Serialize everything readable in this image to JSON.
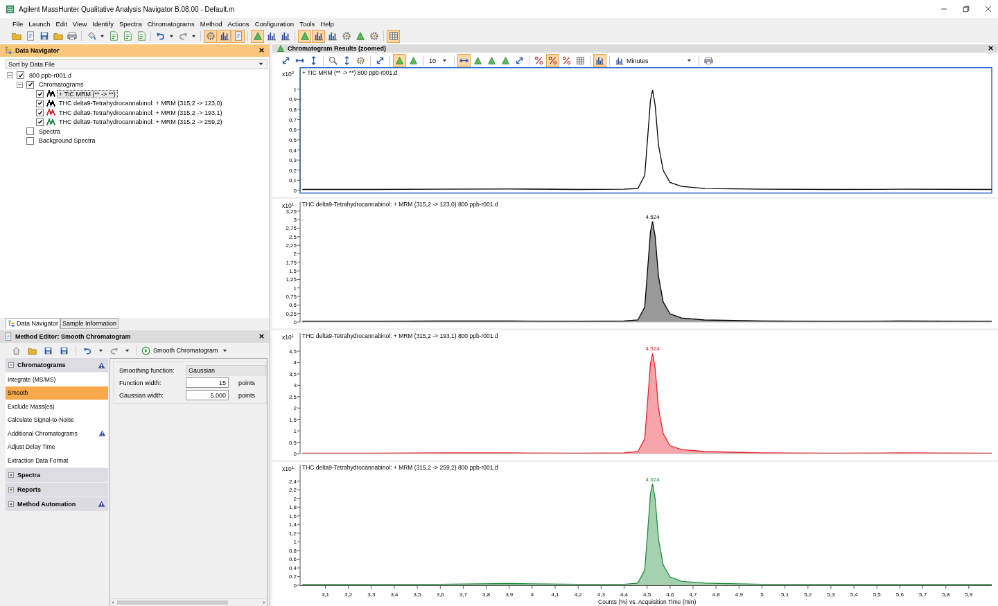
{
  "window": {
    "title": "Agilent MassHunter Qualitative Analysis Navigator B.08.00 - Default.m"
  },
  "menu": [
    "File",
    "Launch",
    "Edit",
    "View",
    "Identify",
    "Spectra",
    "Chromatograms",
    "Method",
    "Actions",
    "Configuration",
    "Tools",
    "Help"
  ],
  "main_toolbar": [
    {
      "pressed": false
    },
    {
      "pressed": false
    },
    {
      "pressed": false
    },
    {
      "pressed": false
    },
    {
      "pressed": false
    },
    {
      "pressed": false
    },
    {
      "pressed": false
    },
    {
      "pressed": false
    },
    {
      "pressed": false
    },
    {
      "pressed": false
    },
    {
      "pressed": false
    },
    {
      "pressed": true
    },
    {
      "pressed": true
    },
    {
      "pressed": true
    },
    {
      "pressed": true
    },
    {
      "pressed": false
    },
    {
      "pressed": false
    },
    {
      "pressed": true
    },
    {
      "pressed": true
    },
    {
      "pressed": false
    },
    {
      "pressed": false
    },
    {
      "pressed": false
    },
    {
      "pressed": false
    },
    {
      "pressed": true
    }
  ],
  "data_navigator": {
    "title": "Data Navigator",
    "sort": "Sort by Data File",
    "tree": [
      {
        "label": "800 ppb-r001.d",
        "checked": true,
        "expanded": true,
        "children": [
          {
            "label": "Chromatograms",
            "checked": true,
            "expanded": true,
            "children": [
              {
                "label": "+ TIC MRM (** -> **)",
                "checked": true,
                "color": "#000000",
                "selected": true
              },
              {
                "label": "THC  delta9-Tetrahydrocannabinol: + MRM (315,2 -> 123,0)",
                "checked": true,
                "color": "#000000",
                "selected": false
              },
              {
                "label": "THC  delta9-Tetrahydrocannabinol: + MRM (315,2 -> 193,1)",
                "checked": true,
                "color": "#e8202a",
                "selected": false
              },
              {
                "label": "THC  delta9-Tetrahydrocannabinol: + MRM (315,2 -> 259,2)",
                "checked": true,
                "color": "#1e8c3c",
                "selected": false
              }
            ]
          },
          {
            "label": "Spectra",
            "checked": false
          },
          {
            "label": "Background Spectra",
            "checked": false
          }
        ]
      }
    ]
  },
  "left_tabs": [
    {
      "label": "Data Navigator",
      "selected": true
    },
    {
      "label": "Sample Information",
      "selected": false
    }
  ],
  "method_editor": {
    "title": "Method Editor: Smooth Chromatogram",
    "action": "Smooth Chromatogram",
    "groups": [
      {
        "label": "Chromatograms",
        "expanded": true,
        "alert": true,
        "items": [
          {
            "label": "Integrate (MS/MS)",
            "selected": false,
            "alert": false
          },
          {
            "label": "Smooth",
            "selected": true,
            "alert": false
          },
          {
            "label": "Exclude Mass(es)",
            "selected": false,
            "alert": false
          },
          {
            "label": "Calculate Signal-to-Noise",
            "selected": false,
            "alert": false
          },
          {
            "label": "Additional Chromatograms",
            "selected": false,
            "alert": true
          },
          {
            "label": "Adjust Delay Time",
            "selected": false,
            "alert": false
          },
          {
            "label": "Extraction Data Format",
            "selected": false,
            "alert": false
          }
        ]
      },
      {
        "label": "Spectra",
        "expanded": false,
        "alert": false
      },
      {
        "label": "Reports",
        "expanded": false,
        "alert": false
      },
      {
        "label": "Method Automation",
        "expanded": false,
        "alert": true
      }
    ],
    "fields": [
      {
        "label": "Smoothing function:",
        "value": "Gaussian",
        "kind": "readonly"
      },
      {
        "label": "Function width:",
        "value": "15",
        "unit": "points",
        "kind": "number"
      },
      {
        "label": "Gaussian width:",
        "value": "5.000",
        "unit": "points",
        "kind": "number"
      }
    ]
  },
  "results": {
    "title": "Chromatogram Results (zoomed)",
    "toolbar": [
      {
        "kind": "button",
        "pressed": false
      },
      {
        "kind": "button",
        "pressed": false
      },
      {
        "kind": "button",
        "pressed": false
      },
      {
        "kind": "button",
        "pressed": false
      },
      {
        "kind": "button",
        "pressed": false
      },
      {
        "kind": "button",
        "pressed": false
      },
      {
        "kind": "button",
        "pressed": false
      },
      {
        "kind": "button",
        "pressed": true
      },
      {
        "kind": "button",
        "pressed": false
      },
      {
        "kind": "dropdown",
        "value": "10"
      },
      {
        "kind": "button",
        "pressed": true
      },
      {
        "kind": "button",
        "pressed": false
      },
      {
        "kind": "button",
        "pressed": false
      },
      {
        "kind": "button",
        "pressed": false
      },
      {
        "kind": "button",
        "pressed": false
      },
      {
        "kind": "button",
        "pressed": false
      },
      {
        "kind": "button",
        "pressed": true
      },
      {
        "kind": "button",
        "pressed": false
      },
      {
        "kind": "button",
        "pressed": false
      },
      {
        "kind": "button",
        "pressed": true
      },
      {
        "kind": "dropdown",
        "value": "Minutes"
      },
      {
        "kind": "button",
        "pressed": false
      }
    ],
    "panes": [
      {
        "selected": true,
        "multiplier": {
          "base": "x10",
          "exponent": "2"
        },
        "chart_data": {
          "type": "line",
          "title": "+ TIC MRM (** -> **) 800 ppb-r001.d",
          "x": [
            3.0,
            3.3,
            3.6,
            3.9,
            4.2,
            4.4,
            4.46,
            4.49,
            4.505,
            4.515,
            4.524,
            4.535,
            4.55,
            4.57,
            4.6,
            4.65,
            4.75,
            5.0,
            5.3,
            5.6,
            6.0
          ],
          "series": [
            {
              "color": "#000000",
              "values": [
                0.01,
                0.01,
                0.012,
                0.015,
                0.01,
                0.012,
                0.02,
                0.149,
                0.594,
                0.891,
                0.99,
                0.842,
                0.446,
                0.198,
                0.079,
                0.04,
                0.02,
                0.012,
                0.01,
                0.012,
                0.01
              ]
            }
          ],
          "xlim": [
            2.99,
            6.0
          ],
          "ylim": [
            0,
            1.19
          ],
          "yticks": [
            {
              "value": 0,
              "label": "0"
            },
            {
              "value": 0.1,
              "label": "0,1"
            },
            {
              "value": 0.2,
              "label": "0,2"
            },
            {
              "value": 0.3,
              "label": "0,3"
            },
            {
              "value": 0.4,
              "label": "0,4"
            },
            {
              "value": 0.5,
              "label": "0,5"
            },
            {
              "value": 0.6,
              "label": "0,6"
            },
            {
              "value": 0.7,
              "label": "0,7"
            },
            {
              "value": 0.8,
              "label": "0,8"
            },
            {
              "value": 0.9,
              "label": "0,9"
            },
            {
              "value": 1,
              "label": "1"
            }
          ]
        }
      },
      {
        "selected": false,
        "multiplier": {
          "base": "x10",
          "exponent": "1"
        },
        "chart_data": {
          "type": "area",
          "title": "THC  delta9-Tetrahydrocannabinol: + MRM (315,2 -> 123,0) 800 ppb-r001.d",
          "x": [
            3.0,
            3.3,
            3.6,
            3.9,
            4.2,
            4.4,
            4.46,
            4.49,
            4.505,
            4.515,
            4.524,
            4.535,
            4.55,
            4.57,
            4.6,
            4.65,
            4.75,
            5.0,
            5.3,
            5.6,
            6.0
          ],
          "series": [
            {
              "color": "#000000",
              "values": [
                0.02,
                0.02,
                0.03,
                0.03,
                0.02,
                0.03,
                0.06,
                0.44,
                1.77,
                2.66,
                2.95,
                2.51,
                1.33,
                0.59,
                0.24,
                0.12,
                0.06,
                0.03,
                0.02,
                0.03,
                0.02
              ]
            }
          ],
          "xlim": [
            2.99,
            6.0
          ],
          "ylim": [
            0,
            3.53
          ],
          "yticks": [
            {
              "value": 0,
              "label": "0"
            },
            {
              "value": 0.25,
              "label": "0,25"
            },
            {
              "value": 0.5,
              "label": "0,5"
            },
            {
              "value": 0.75,
              "label": "0,75"
            },
            {
              "value": 1,
              "label": "1"
            },
            {
              "value": 1.25,
              "label": "1,25"
            },
            {
              "value": 1.5,
              "label": "1,5"
            },
            {
              "value": 1.75,
              "label": "1,75"
            },
            {
              "value": 2,
              "label": "2"
            },
            {
              "value": 2.25,
              "label": "2,25"
            },
            {
              "value": 2.5,
              "label": "2,5"
            },
            {
              "value": 2.75,
              "label": "2,75"
            },
            {
              "value": 3,
              "label": "3"
            },
            {
              "value": 3.25,
              "label": "3,25"
            }
          ],
          "annotations": [
            {
              "text": "4.524"
            }
          ]
        }
      },
      {
        "selected": false,
        "multiplier": {
          "base": "x10",
          "exponent": "1"
        },
        "chart_data": {
          "type": "area",
          "title": "THC  delta9-Tetrahydrocannabinol: + MRM (315,2 -> 193,1) 800 ppb-r001.d",
          "x": [
            3.0,
            3.3,
            3.6,
            3.9,
            4.2,
            4.4,
            4.46,
            4.49,
            4.505,
            4.515,
            4.524,
            4.535,
            4.55,
            4.57,
            4.6,
            4.65,
            4.75,
            5.0,
            5.3,
            5.6,
            6.0
          ],
          "series": [
            {
              "color": "#e8202a",
              "values": [
                0.02,
                0.02,
                0.03,
                0.03,
                0.02,
                0.03,
                0.09,
                0.66,
                2.64,
                3.96,
                4.4,
                3.74,
                1.98,
                0.88,
                0.35,
                0.18,
                0.09,
                0.03,
                0.02,
                0.03,
                0.02
              ]
            }
          ],
          "xlim": [
            2.99,
            6.0
          ],
          "ylim": [
            0,
            5.29
          ],
          "yticks": [
            {
              "value": 0,
              "label": "0"
            },
            {
              "value": 0.5,
              "label": "0.5"
            },
            {
              "value": 1,
              "label": "1"
            },
            {
              "value": 1.5,
              "label": "1,5"
            },
            {
              "value": 2,
              "label": "2"
            },
            {
              "value": 2.5,
              "label": "2,5"
            },
            {
              "value": 3,
              "label": "3"
            },
            {
              "value": 3.5,
              "label": "3,5"
            },
            {
              "value": 4,
              "label": "4"
            },
            {
              "value": 4.5,
              "label": "4,5"
            }
          ],
          "annotations": [
            {
              "text": "4.524"
            }
          ]
        }
      },
      {
        "selected": false,
        "multiplier": {
          "base": "x10",
          "exponent": "1"
        },
        "chart_data": {
          "type": "area",
          "title": "THC  delta9-Tetrahydrocannabinol: + MRM (315,2 -> 259,2) 800 ppb-r001.d",
          "xlabel": "Counts (%) vs. Acquisition Time (min)",
          "x": [
            3.0,
            3.3,
            3.6,
            3.9,
            4.2,
            4.4,
            4.46,
            4.49,
            4.505,
            4.515,
            4.524,
            4.535,
            4.55,
            4.57,
            4.6,
            4.65,
            4.75,
            5.0,
            5.3,
            5.6,
            6.0
          ],
          "series": [
            {
              "color": "#1e8c3c",
              "values": [
                0.02,
                0.02,
                0.02,
                0.04,
                0.02,
                0.02,
                0.05,
                0.35,
                1.4,
                2.11,
                2.34,
                1.99,
                1.05,
                0.47,
                0.19,
                0.09,
                0.05,
                0.02,
                0.02,
                0.02,
                0.02
              ]
            }
          ],
          "xlim": [
            2.99,
            6.0
          ],
          "ylim": [
            0,
            2.78
          ],
          "xticks": [
            {
              "value": 3.1,
              "label": "3,1"
            },
            {
              "value": 3.2,
              "label": "3,2"
            },
            {
              "value": 3.3,
              "label": "3,3"
            },
            {
              "value": 3.4,
              "label": "3,4"
            },
            {
              "value": 3.5,
              "label": "3,5"
            },
            {
              "value": 3.6,
              "label": "3,6"
            },
            {
              "value": 3.7,
              "label": "3,7"
            },
            {
              "value": 3.8,
              "label": "3,8"
            },
            {
              "value": 3.9,
              "label": "3,9"
            },
            {
              "value": 4,
              "label": "4"
            },
            {
              "value": 4.1,
              "label": "4,1"
            },
            {
              "value": 4.2,
              "label": "4,2"
            },
            {
              "value": 4.3,
              "label": "4,3"
            },
            {
              "value": 4.4,
              "label": "4,4"
            },
            {
              "value": 4.5,
              "label": "4,5"
            },
            {
              "value": 4.6,
              "label": "4,6"
            },
            {
              "value": 4.7,
              "label": "4,7"
            },
            {
              "value": 4.8,
              "label": "4,8"
            },
            {
              "value": 4.9,
              "label": "4,9"
            },
            {
              "value": 5,
              "label": "5"
            },
            {
              "value": 5.1,
              "label": "5,1"
            },
            {
              "value": 5.2,
              "label": "5,2"
            },
            {
              "value": 5.3,
              "label": "5,3"
            },
            {
              "value": 5.4,
              "label": "5,4"
            },
            {
              "value": 5.5,
              "label": "5,5"
            },
            {
              "value": 5.6,
              "label": "5,6"
            },
            {
              "value": 5.7,
              "label": "5,7"
            },
            {
              "value": 5.8,
              "label": "5,8"
            },
            {
              "value": 5.9,
              "label": "5,9"
            }
          ],
          "yticks": [
            {
              "value": 0,
              "label": "0"
            },
            {
              "value": 0.2,
              "label": "0.2"
            },
            {
              "value": 0.4,
              "label": "0.4"
            },
            {
              "value": 0.6,
              "label": "0.6"
            },
            {
              "value": 0.8,
              "label": "0.8"
            },
            {
              "value": 1,
              "label": "1"
            },
            {
              "value": 1.2,
              "label": "1,2"
            },
            {
              "value": 1.4,
              "label": "1,4"
            },
            {
              "value": 1.6,
              "label": "1,6"
            },
            {
              "value": 1.8,
              "label": "1,8"
            },
            {
              "value": 2,
              "label": "2"
            },
            {
              "value": 2.2,
              "label": "2,2"
            },
            {
              "value": 2.4,
              "label": "2,4"
            }
          ],
          "annotations": [
            {
              "text": "4.524"
            }
          ]
        }
      }
    ]
  }
}
